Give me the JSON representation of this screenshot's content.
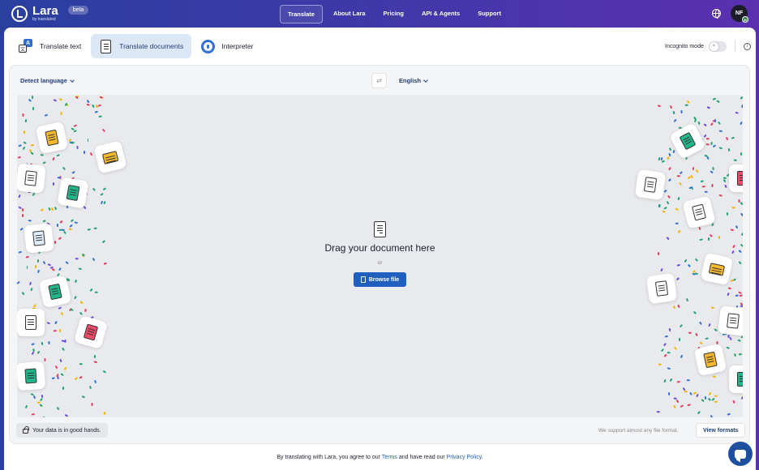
{
  "app": {
    "name": "Lara",
    "by": "by translated",
    "badge": "beta"
  },
  "nav": {
    "items": [
      {
        "label": "Translate",
        "active": true
      },
      {
        "label": "About Lara",
        "active": false
      },
      {
        "label": "Pricing",
        "active": false
      },
      {
        "label": "API & Agents",
        "active": false
      },
      {
        "label": "Support",
        "active": false
      }
    ]
  },
  "user": {
    "initials": "NF",
    "badge_initial": "M"
  },
  "tabs": [
    {
      "label": "Translate text",
      "icon": "translate-icon",
      "active": false
    },
    {
      "label": "Translate documents",
      "icon": "document-icon",
      "active": true
    },
    {
      "label": "Interpreter",
      "icon": "interpreter-icon",
      "active": false
    }
  ],
  "incognito": {
    "label": "Incognito mode",
    "enabled": false,
    "toggle_glyph": "×",
    "info_glyph": "i"
  },
  "languages": {
    "source": "Detect language",
    "target": "English",
    "swap_glyph": "⇄"
  },
  "dropzone": {
    "title": "Drag your document here",
    "or": "or",
    "browse_label": "Browse file"
  },
  "bottom": {
    "safe_text": "Your data is in good hands.",
    "support_text": "We support almost any file format.",
    "view_formats": "View formats"
  },
  "footer": {
    "prefix": "By translating with Lara, you agree to our",
    "terms": "Terms",
    "middle": "and have read our",
    "privacy": "Privacy Policy",
    "suffix": "."
  },
  "colors": {
    "header_start": "#2a3f9e",
    "header_end": "#5a2fb0",
    "accent": "#1f5fbf",
    "active_tab": "#dce7f6",
    "confetti": [
      "#1fa36b",
      "#f2b400",
      "#e33b5c",
      "#6a4be0",
      "#2f6fd6",
      "#1fa36b"
    ]
  },
  "file_tiles": [
    {
      "icon": "note-icon",
      "color": "#f5b82e"
    },
    {
      "icon": "envelope-icon",
      "color": "#f5b82e"
    },
    {
      "icon": "text-file-icon",
      "color": "#ffffff"
    },
    {
      "icon": "sheet-icon",
      "color": "#22b58a"
    },
    {
      "icon": "binary-file-icon",
      "color": "#dfeeff"
    },
    {
      "icon": "spreadsheet-icon",
      "color": "#22b58a"
    },
    {
      "icon": "code-file-icon",
      "color": "#ffffff"
    },
    {
      "icon": "pdf-file-icon",
      "color": "#ef4a6a"
    },
    {
      "icon": "sheet-icon",
      "color": "#22b58a"
    },
    {
      "icon": "spreadsheet-icon",
      "color": "#22b58a"
    },
    {
      "icon": "code-file-icon",
      "color": "#ffffff"
    },
    {
      "icon": "text-file-icon",
      "color": "#ffffff"
    },
    {
      "icon": "pdf-file-icon",
      "color": "#ef4a6a"
    },
    {
      "icon": "envelope-icon",
      "color": "#f5b82e"
    },
    {
      "icon": "text-file-icon",
      "color": "#ffffff"
    },
    {
      "icon": "code-file-icon",
      "color": "#ffffff"
    },
    {
      "icon": "note-icon",
      "color": "#f5b82e"
    },
    {
      "icon": "sheet-icon",
      "color": "#22b58a"
    }
  ]
}
